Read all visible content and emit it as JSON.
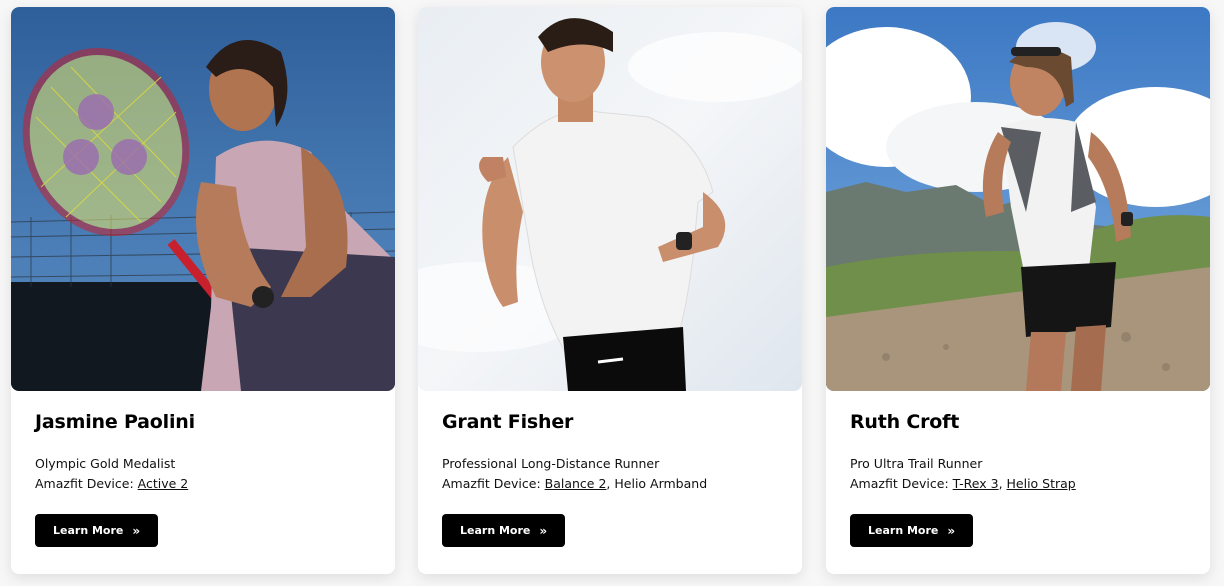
{
  "athletes": [
    {
      "name": "Jasmine Paolini",
      "title": "Olympic Gold Medalist",
      "device_label": "Amazfit Device:",
      "devices": [
        {
          "text": "Active 2",
          "link": true
        }
      ],
      "button": "Learn More",
      "button_icon": "»",
      "photo_icon": "tennis-player-photo"
    },
    {
      "name": "Grant Fisher",
      "title": "Professional Long-Distance Runner",
      "device_label": "Amazfit Device:",
      "devices": [
        {
          "text": "Balance 2",
          "link": true
        },
        {
          "text": "Helio Armband",
          "link": false
        }
      ],
      "button": "Learn More",
      "button_icon": "»",
      "photo_icon": "runner-photo"
    },
    {
      "name": "Ruth Croft",
      "title": "Pro Ultra Trail Runner",
      "device_label": "Amazfit Device:",
      "devices": [
        {
          "text": "T-Rex 3",
          "link": true
        },
        {
          "text": "Helio Strap",
          "link": true
        }
      ],
      "button": "Learn More",
      "button_icon": "»",
      "photo_icon": "trail-runner-photo"
    }
  ],
  "separator": ", ",
  "colors": {
    "card_bg": "#ffffff",
    "page_bg": "#f7f7f7",
    "button_bg": "#000000",
    "button_text": "#ffffff"
  }
}
